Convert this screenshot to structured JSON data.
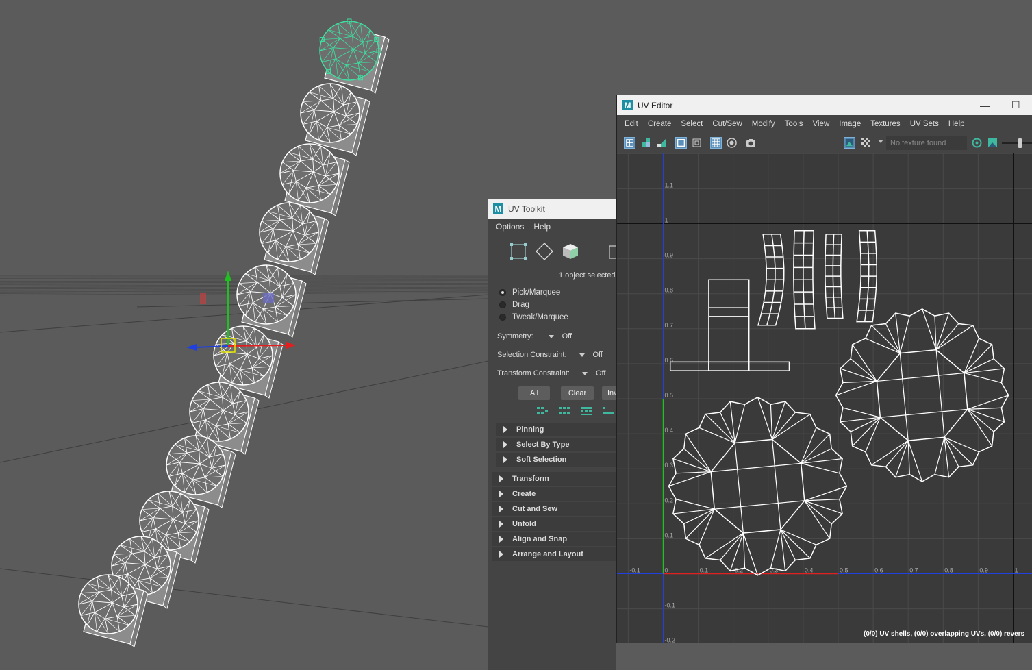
{
  "uv_toolkit": {
    "title": "UV Toolkit",
    "menu": [
      "Options",
      "Help"
    ],
    "selection_info": "1 object selected",
    "tools": [
      {
        "label": "Pick/Marquee",
        "selected": true
      },
      {
        "label": "Drag",
        "selected": false
      },
      {
        "label": "Tweak/Marquee",
        "selected": false
      }
    ],
    "symmetry": {
      "label": "Symmetry:",
      "value": "Off"
    },
    "selection_constraint": {
      "label": "Selection Constraint:",
      "value": "Off"
    },
    "transform_constraint": {
      "label": "Transform Constraint:",
      "value": "Off"
    },
    "buttons": {
      "all": "All",
      "clear": "Clear",
      "invert": "Inv"
    },
    "subsections": [
      "Pinning",
      "Select By Type",
      "Soft Selection"
    ],
    "sections": [
      "Transform",
      "Create",
      "Cut and Sew",
      "Unfold",
      "Align and Snap",
      "Arrange and Layout"
    ]
  },
  "uv_editor": {
    "title": "UV Editor",
    "menu": [
      "Edit",
      "Create",
      "Select",
      "Cut/Sew",
      "Modify",
      "Tools",
      "View",
      "Image",
      "Textures",
      "UV Sets",
      "Help"
    ],
    "texture_field": "No texture found",
    "status": "(0/0) UV shells, (0/0) overlapping UVs, (0/0) revers",
    "grid_labels_x": [
      "-0.1",
      "0",
      "0.1",
      "0.2",
      "0.3",
      "0.4",
      "0.5",
      "0.6",
      "0.7",
      "0.8",
      "0.9",
      "1"
    ],
    "grid_labels_y": [
      "1.1",
      "1",
      "0.9",
      "0.8",
      "0.7",
      "0.6",
      "0.5",
      "0.4",
      "0.3",
      "0.2",
      "0.1",
      "-0.1",
      "-0.2"
    ]
  },
  "colors": {
    "viewport_bg": "#5b5b5b",
    "wire": "#ffffff",
    "selected_wire": "#3de0a0",
    "axis_x": "#e02020",
    "axis_y": "#20c020",
    "axis_z": "#2040e0",
    "uv_bg": "#3a3a3a",
    "uv_grid": "#4a4a4a"
  }
}
